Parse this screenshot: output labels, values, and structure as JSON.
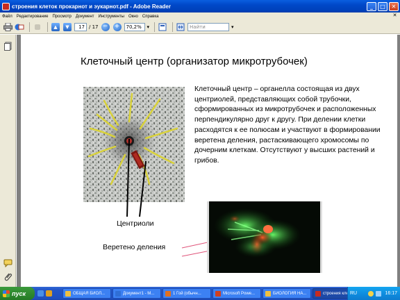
{
  "window": {
    "title": "строения клеток прокарнот и эукарнот.pdf - Adobe Reader"
  },
  "menu": [
    "Файл",
    "Редактирование",
    "Просмотр",
    "Документ",
    "Инструменты",
    "Окно",
    "Справка"
  ],
  "toolbar": {
    "page_current": "17",
    "page_total": "/ 17",
    "zoom": "70,2%",
    "search_placeholder": "Найти"
  },
  "slide": {
    "title": "Клеточный центр (организатор микротрубочек)",
    "body": "Клеточный центр – органелла состоящая из двух центриолей, представляющих собой трубочки, сформированных из микротрубочек и расположенных перпендикулярно друг к другу. При делении клетки расходятся к ее полюсам и участвуют в формировании веретена деления, растаскивающего хромосомы по дочерним клеткам. Отсутствуют у высших растений и грибов.",
    "label_centrioles": "Центриоли",
    "label_spindle": "Веретено деления"
  },
  "taskbar": {
    "start_label": "пуск",
    "tasks": [
      {
        "label": "ОБЩАЯ БИОЛ...",
        "color": "#f0c040"
      },
      {
        "label": "Документ1 - М...",
        "color": "#2f6fd6"
      },
      {
        "label": "1 Гой (обычн...",
        "color": "#e07020"
      },
      {
        "label": "Microsoft Powe...",
        "color": "#d04020"
      },
      {
        "label": "БИОЛОГИЯ НА...",
        "color": "#f0c040"
      },
      {
        "label": "строения клет...",
        "color": "#c62b20"
      }
    ],
    "active_task_index": 5,
    "language": "RU",
    "clock": "16:17"
  }
}
